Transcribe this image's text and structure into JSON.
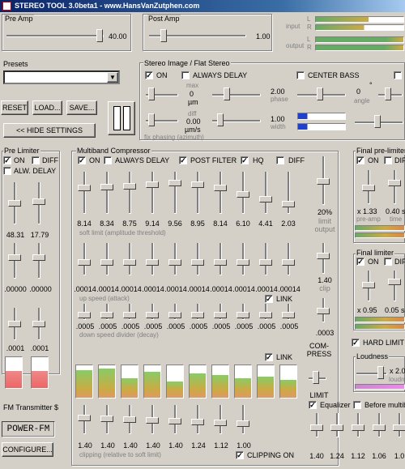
{
  "title": "STEREO TOOL 3.0beta1 - www.HansVanZutphen.com",
  "pre_amp": {
    "label": "Pre Amp",
    "value": "40.00"
  },
  "post_amp": {
    "label": "Post Amp",
    "value": "1.00"
  },
  "meters": {
    "input": "input",
    "output": "output",
    "L": "L",
    "R": "R"
  },
  "presets": {
    "label": "Presets",
    "value": ""
  },
  "buttons": {
    "reset": "RESET",
    "load": "LOAD...",
    "save": "SAVE...",
    "hide": "<< HIDE SETTINGS",
    "power_fm": "POWER-FM",
    "configure": "CONFIGURE..."
  },
  "stereo": {
    "label": "Stereo Image / Flat Stereo",
    "on": "ON",
    "always_delay": "ALWAYS DELAY",
    "center_bass": "CENTER BASS",
    "max": "max",
    "max_val": "0",
    "max_unit": "µm",
    "phase": "phase",
    "phase_val": "2.00",
    "diff": "diff",
    "diff_val": "0.00",
    "diff_unit": "µm/s",
    "width": "width",
    "width_val": "1.00",
    "angle_val": "0",
    "angle_sym": "°",
    "angle": "angle",
    "fix_phasing": "fix phasing (azimuth)"
  },
  "pre_limiter": {
    "label": "Pre Limiter",
    "on": "ON",
    "diff": "DIFF",
    "alw_delay": "ALW. DELAY",
    "v1": "48.31",
    "v2": "17.79",
    "s1": ".00000",
    "s2": ".00000",
    "d1": ".0001",
    "d2": ".0001"
  },
  "mbc": {
    "label": "Multiband Compressor",
    "on": "ON",
    "always_delay": "ALWAYS DELAY",
    "post_filter": "POST FILTER",
    "hq": "HQ",
    "diff": "DIFF",
    "soft_limit": [
      "8.14",
      "8.34",
      "8.75",
      "9.14",
      "9.56",
      "8.95",
      "8.14",
      "6.10",
      "4.41",
      "2.03"
    ],
    "soft_limit_label": "soft limit (amplitude threshold)",
    "up_speed": [
      ".00014",
      ".00014",
      ".00014",
      ".00014",
      ".00014",
      ".00014",
      ".00014",
      ".00014",
      ".00014",
      ".00014"
    ],
    "up_speed_label": "up speed (attack)",
    "down_speed": [
      ".0005",
      ".0005",
      ".0005",
      ".0005",
      ".0005",
      ".0005",
      ".0005",
      ".0005",
      ".0005",
      ".0005"
    ],
    "down_speed_label": "down speed divider (decay)",
    "link": "LINK",
    "clipping": [
      "1.40",
      "1.40",
      "1.40",
      "1.40",
      "1.40",
      "1.24",
      "1.12",
      "1.00"
    ],
    "clipping_label": "clipping (relative to soft limit)",
    "clipping_on": "CLIPPING ON",
    "limit_pct": "20%",
    "limit_label": "limit",
    "output_label": "output",
    "clip_val": "1.40",
    "clip_label": "clip",
    "small_val": ".0003",
    "compress": "COM-\nPRESS",
    "limit2": "LIMIT",
    "band_levels": [
      0.85,
      0.9,
      0.6,
      0.8,
      0.5,
      0.75,
      0.7,
      0.6,
      0.65,
      0.55
    ]
  },
  "final_pre": {
    "label": "Final pre-limiter",
    "on": "ON",
    "diff": "DIFF",
    "preamp_val": "x 1.33",
    "preamp": "pre-amp",
    "time_val": "0.40 s",
    "time": "time"
  },
  "final_lim": {
    "label": "Final limiter",
    "on": "ON",
    "diff": "DIFF",
    "v1": "x 0.95",
    "v2": "0.05 s"
  },
  "hard_limit": "HARD LIMIT",
  "loudness": {
    "label": "Loudness",
    "val": "x 2.0",
    "unit": "loudn"
  },
  "eq": {
    "equalizer": "Equalizer",
    "before": "Before multib",
    "vals": [
      "1.40",
      "1.24",
      "1.12",
      "1.06",
      "1.0"
    ]
  },
  "fm": {
    "label": "FM Transmitter $"
  }
}
